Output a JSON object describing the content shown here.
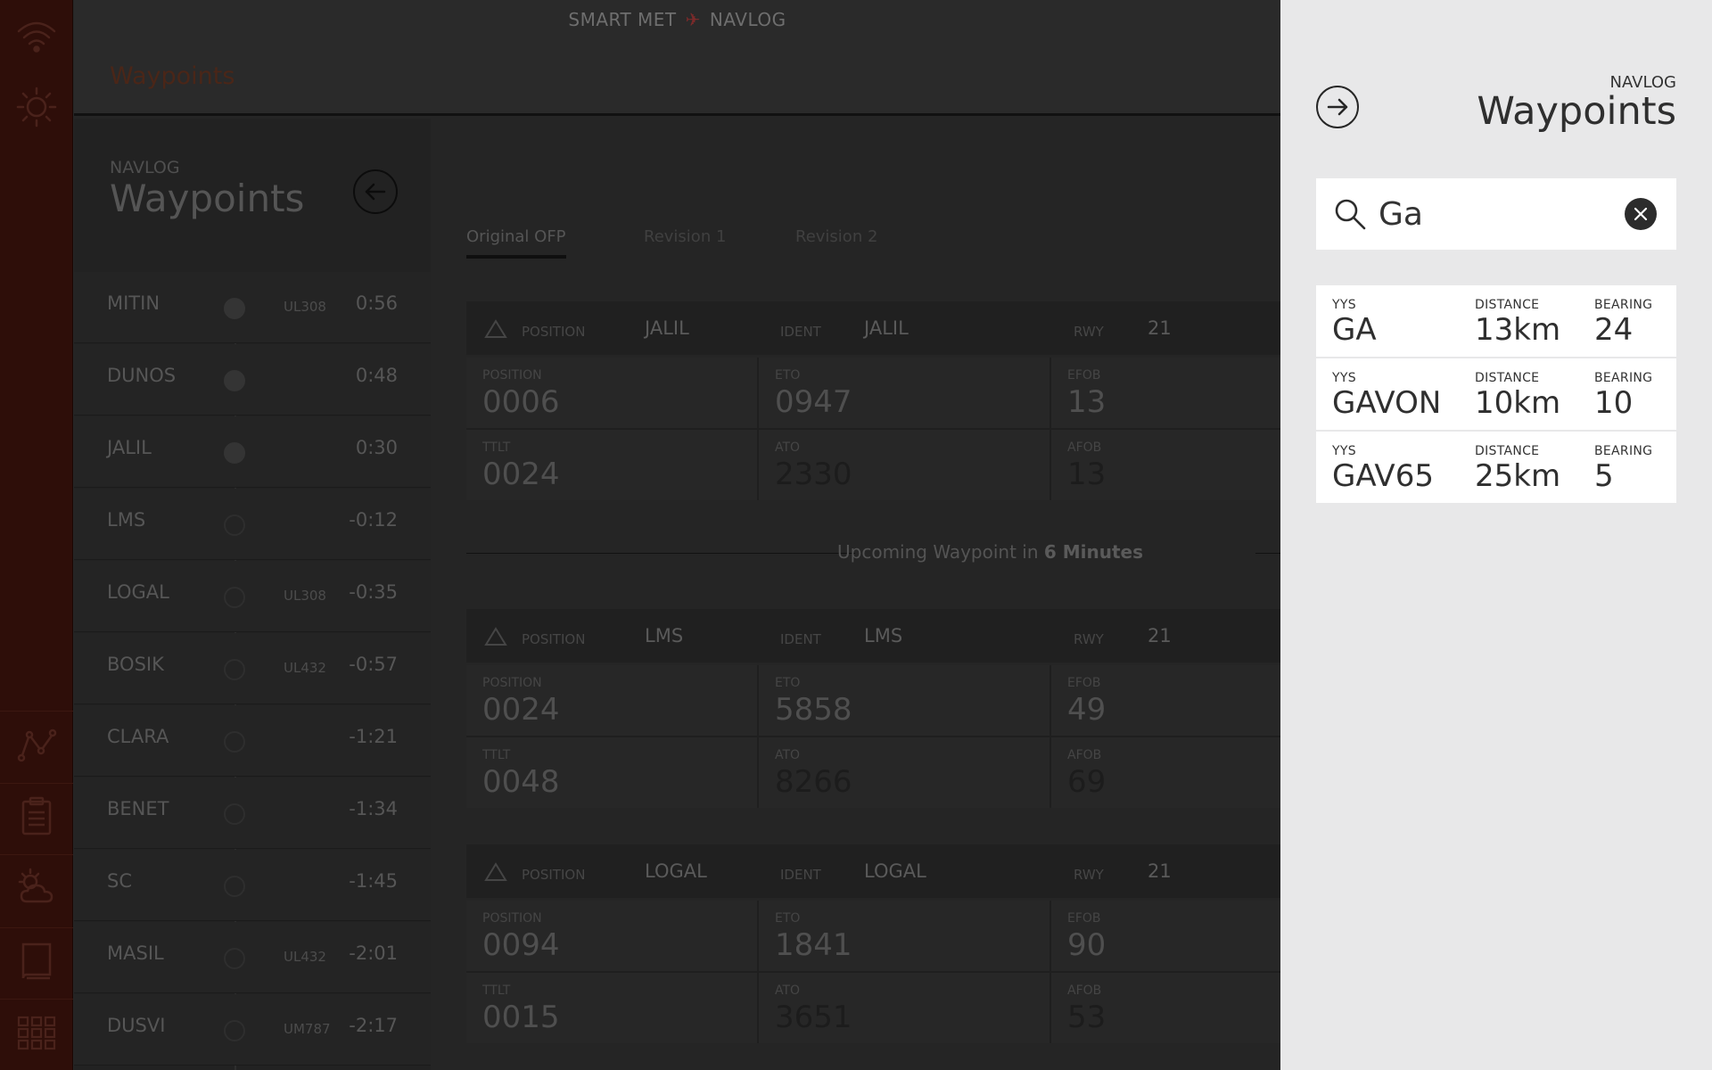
{
  "app": {
    "brand_left": "SMART MET",
    "brand_right": "NAVLOG",
    "page_heading": "Waypoints"
  },
  "list": {
    "navlog_label": "NAVLOG",
    "title": "Waypoints",
    "waypoints": [
      {
        "name": "MITIN",
        "airway": "UL308",
        "time": "0:56",
        "passed": true
      },
      {
        "name": "DUNOS",
        "airway": "",
        "time": "0:48",
        "passed": true
      },
      {
        "name": "JALIL",
        "airway": "",
        "time": "0:30",
        "passed": true
      },
      {
        "name": "LMS",
        "airway": "",
        "time": "-0:12",
        "passed": false
      },
      {
        "name": "LOGAL",
        "airway": "UL308",
        "time": "-0:35",
        "passed": false
      },
      {
        "name": "BOSIK",
        "airway": "UL432",
        "time": "-0:57",
        "passed": false
      },
      {
        "name": "CLARA",
        "airway": "",
        "time": "-1:21",
        "passed": false
      },
      {
        "name": "BENET",
        "airway": "",
        "time": "-1:34",
        "passed": false
      },
      {
        "name": "SC",
        "airway": "",
        "time": "-1:45",
        "passed": false
      },
      {
        "name": "MASIL",
        "airway": "UL432",
        "time": "-2:01",
        "passed": false
      },
      {
        "name": "DUSVI",
        "airway": "UM787",
        "time": "-2:17",
        "passed": false
      }
    ]
  },
  "revision_tabs": [
    "Original OFP",
    "Revision 1",
    "Revision 2"
  ],
  "labels": {
    "position": "POSITION",
    "ident": "IDENT",
    "rwy": "RWY",
    "ttlt": "TTLT",
    "eto": "ETO",
    "ato": "ATO",
    "efob": "EFOB",
    "afob": "AFOB"
  },
  "cards": [
    {
      "position": "JALIL",
      "ident": "JALIL",
      "rwy": "21",
      "pos_val": "0006",
      "ttlt": "0024",
      "eto": "0947",
      "ato": "2330",
      "efob": "13",
      "afob": "13"
    },
    {
      "position": "LMS",
      "ident": "LMS",
      "rwy": "21",
      "pos_val": "0024",
      "ttlt": "0048",
      "eto": "5858",
      "ato": "8266",
      "efob": "49",
      "afob": "69"
    },
    {
      "position": "LOGAL",
      "ident": "LOGAL",
      "rwy": "21",
      "pos_val": "0094",
      "ttlt": "0015",
      "eto": "1841",
      "ato": "3651",
      "efob": "90",
      "afob": "53"
    }
  ],
  "upcoming": {
    "prefix": "Upcoming Waypoint in ",
    "highlight": "6 Minutes"
  },
  "panel": {
    "navlog_label": "NAVLOG",
    "title": "Waypoints",
    "search": {
      "value": "Ga",
      "placeholder": ""
    },
    "col_distance": "DISTANCE",
    "col_bearing": "BEARING",
    "results": [
      {
        "airport": "YYS",
        "name": "GA",
        "distance": "13km",
        "bearing": "24"
      },
      {
        "airport": "YYS",
        "name": "GAVON",
        "distance": "10km",
        "bearing": "10"
      },
      {
        "airport": "YYS",
        "name": "GAV65",
        "distance": "25km",
        "bearing": "5"
      }
    ]
  },
  "rail_icons": [
    "wifi-icon",
    "sun-icon",
    "route-icon",
    "clipboard-icon",
    "weather-icon",
    "book-icon",
    "apps-grid-icon"
  ],
  "colors": {
    "rail": "#2e0e09",
    "accent_red": "#7a2a2a",
    "panel_bg": "#e8e8e9"
  }
}
